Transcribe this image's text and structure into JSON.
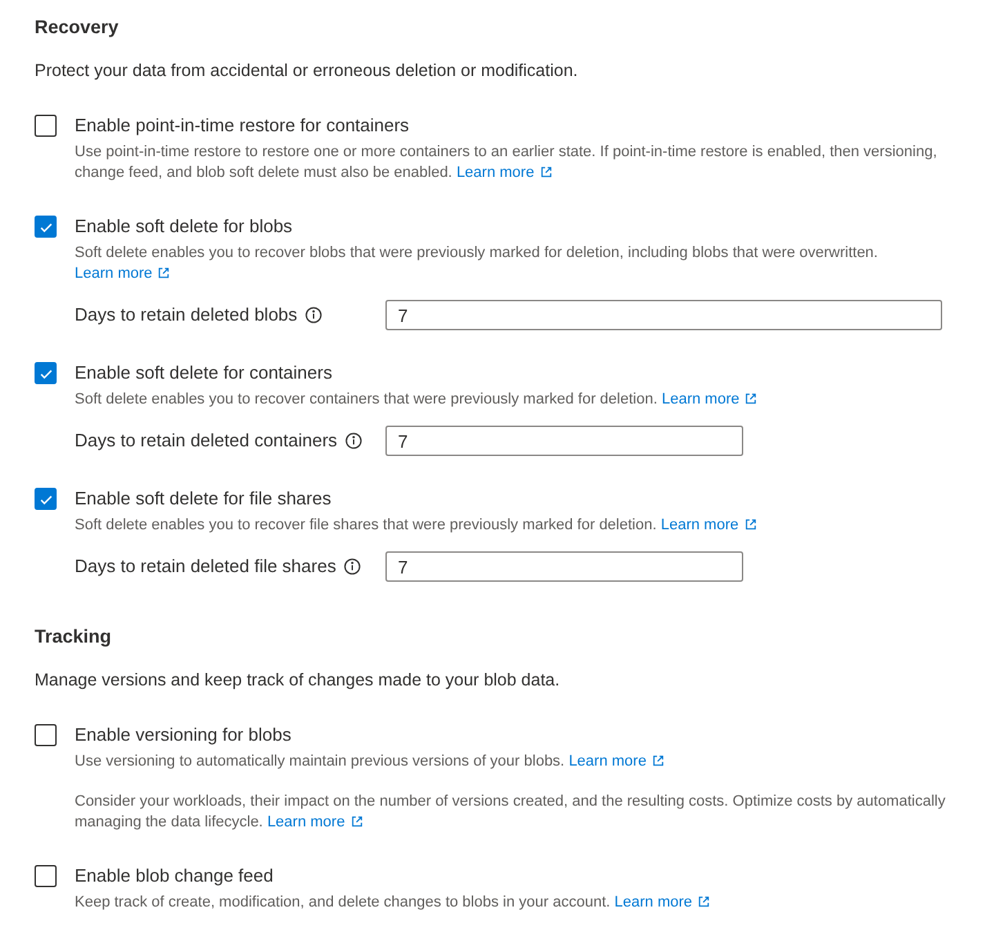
{
  "sections": [
    {
      "title": "Recovery",
      "description": "Protect your data from accidental or erroneous deletion or modification.",
      "options": [
        {
          "label": "Enable point-in-time restore for containers",
          "checked": false,
          "paragraphs": [
            {
              "text": "Use point-in-time restore to restore one or more containers to an earlier state. If point-in-time restore is enabled, then versioning, change feed, and blob soft delete must also be enabled.",
              "link": "Learn more"
            }
          ]
        },
        {
          "label": "Enable soft delete for blobs",
          "checked": true,
          "paragraphs": [
            {
              "text": "Soft delete enables you to recover blobs that were previously marked for deletion, including blobs that were overwritten.",
              "link": "Learn more"
            }
          ],
          "field": {
            "label": "Days to retain deleted blobs",
            "value": "7"
          }
        },
        {
          "label": "Enable soft delete for containers",
          "checked": true,
          "paragraphs": [
            {
              "text": "Soft delete enables you to recover containers that were previously marked for deletion.",
              "link": "Learn more"
            }
          ],
          "field": {
            "label": "Days to retain deleted containers",
            "value": "7"
          }
        },
        {
          "label": "Enable soft delete for file shares",
          "checked": true,
          "paragraphs": [
            {
              "text": "Soft delete enables you to recover file shares that were previously marked for deletion.",
              "link": "Learn more"
            }
          ],
          "field": {
            "label": "Days to retain deleted file shares",
            "value": "7"
          }
        }
      ]
    },
    {
      "title": "Tracking",
      "description": "Manage versions and keep track of changes made to your blob data.",
      "options": [
        {
          "label": "Enable versioning for blobs",
          "checked": false,
          "paragraphs": [
            {
              "text": "Use versioning to automatically maintain previous versions of your blobs.",
              "link": "Learn more"
            },
            {
              "text": "Consider your workloads, their impact on the number of versions created, and the resulting costs. Optimize costs by automatically managing the data lifecycle.",
              "link": "Learn more"
            }
          ]
        },
        {
          "label": "Enable blob change feed",
          "checked": false,
          "paragraphs": [
            {
              "text": "Keep track of create, modification, and delete changes to blobs in your account.",
              "link": "Learn more"
            }
          ]
        }
      ]
    }
  ]
}
